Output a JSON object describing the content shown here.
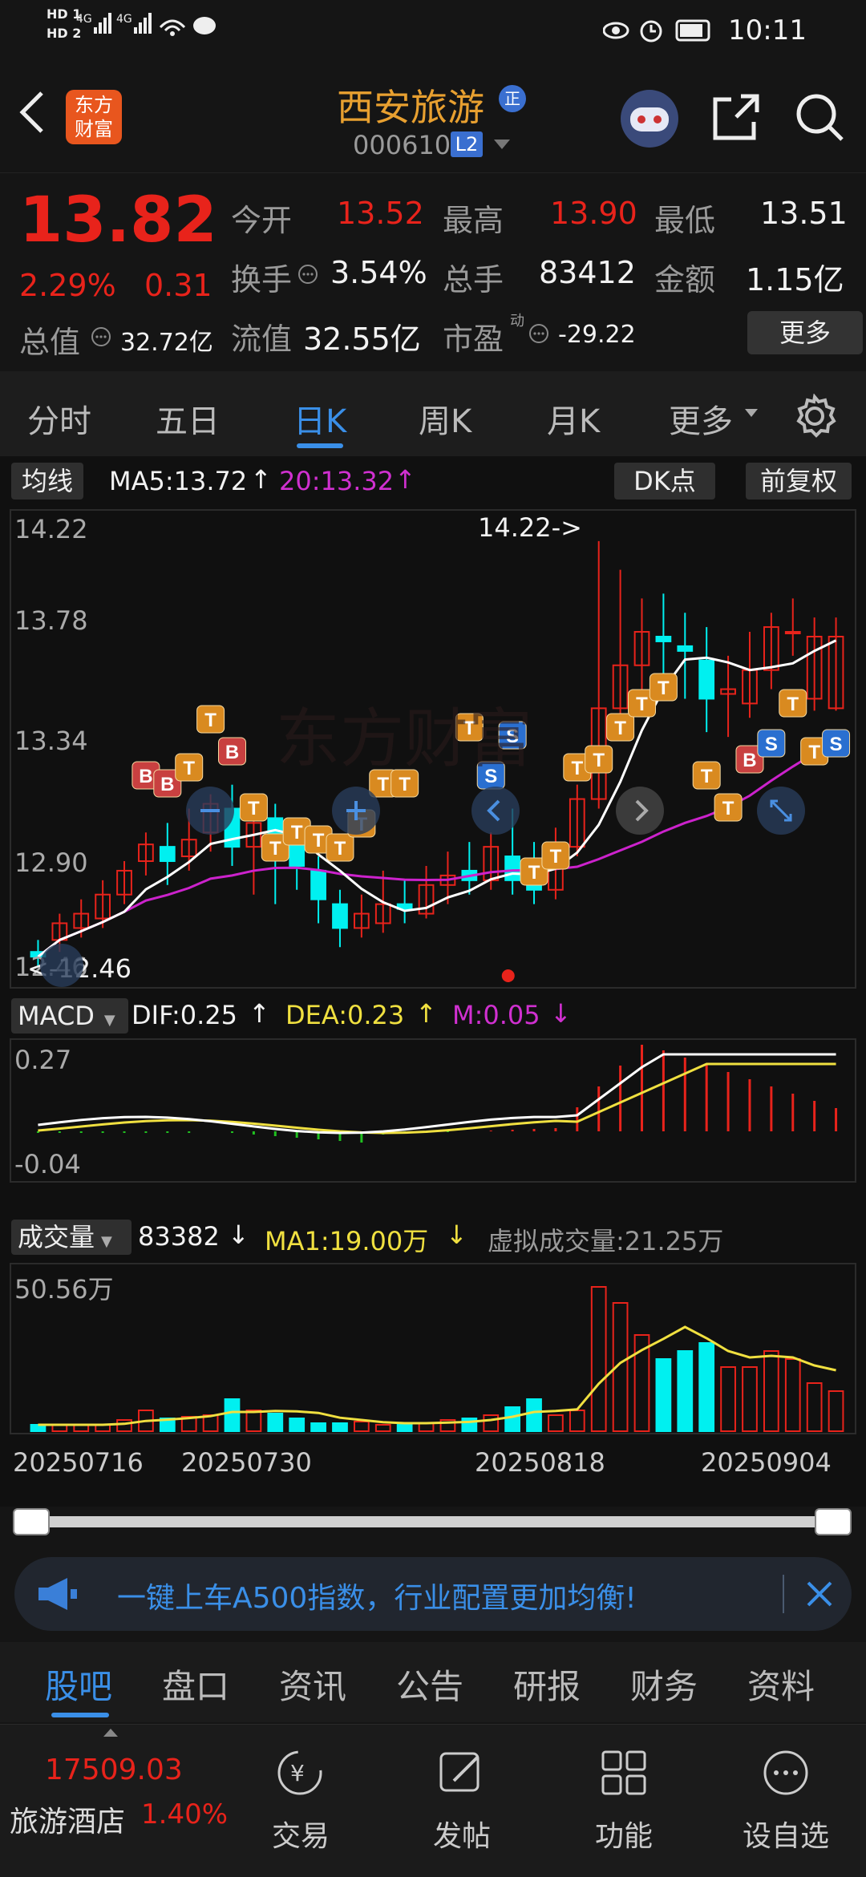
{
  "status_bar": {
    "time": "10:11",
    "sim1": "HD 1",
    "sim2": "HD 2"
  },
  "header": {
    "logo_text": "东方财富",
    "title": "西安旅游",
    "title_badge": "正",
    "code": "000610",
    "level_badge": "L2"
  },
  "quote": {
    "price": "13.82",
    "change_pct": "2.29%",
    "change": "0.31",
    "open_label": "今开",
    "open": "13.52",
    "high_label": "最高",
    "high": "13.90",
    "low_label": "最低",
    "low": "13.51",
    "turnover_label": "换手",
    "turnover": "3.54%",
    "volume_label": "总手",
    "volume": "83412",
    "amount_label": "金额",
    "amount": "1.15亿",
    "mktcap_label": "总值",
    "mktcap": "32.72亿",
    "float_label": "流值",
    "float": "32.55亿",
    "pe_label": "市盈",
    "pe_sup": "动",
    "pe": "-29.22",
    "more_button": "更多"
  },
  "tabs": [
    "分时",
    "五日",
    "日K",
    "周K",
    "月K",
    "更多"
  ],
  "active_tab": "日K",
  "kline": {
    "ma_button": "均线",
    "ma5": "MA5:13.72",
    "ma20": "20:13.32",
    "dk_button": "DK点",
    "fq_button": "前复权",
    "y_labels": [
      "14.22",
      "13.78",
      "13.34",
      "12.90",
      "12.46"
    ],
    "max_annotation": "14.22->",
    "min_annotation": "<-12.46"
  },
  "macd": {
    "button": "MACD",
    "dif": "DIF:0.25",
    "dea": "DEA:0.23",
    "m": "M:0.05",
    "top_label": "0.27",
    "bottom_label": "-0.04"
  },
  "volume": {
    "button": "成交量",
    "value": "83382",
    "ma1": "MA1:19.00万",
    "virtual": "虚拟成交量:21.25万",
    "top_label": "50.56万"
  },
  "dates": [
    "20250716",
    "20250730",
    "20250818",
    "20250904"
  ],
  "banner": {
    "text": "一键上车A500指数，行业配置更加均衡!"
  },
  "subtabs": [
    "股吧",
    "盘口",
    "资讯",
    "公告",
    "研报",
    "财务",
    "资料"
  ],
  "active_subtab": "股吧",
  "bottom": {
    "index_value": "17509.03",
    "index_name": "旅游酒店",
    "index_change": "1.40%",
    "trade": "交易",
    "post": "发帖",
    "func": "功能",
    "watch": "设自选"
  },
  "colors": {
    "up": "#e8231b",
    "down": "#00f0f0",
    "ma5": "#ffffff",
    "ma20": "#cc22cc",
    "dea": "#f0e040",
    "accent": "#2f7fd8",
    "marker_orange": "#d98a20",
    "marker_red": "#c84040",
    "marker_blue": "#2a6fd0"
  }
}
